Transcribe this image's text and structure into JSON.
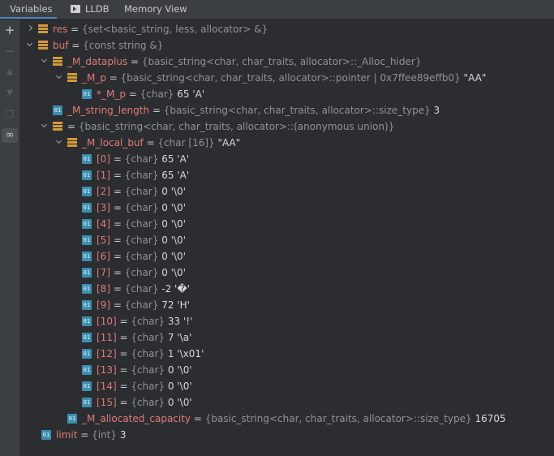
{
  "tabs": [
    {
      "label": "Variables",
      "active": true
    },
    {
      "label": "LLDB",
      "active": false
    },
    {
      "label": "Memory View",
      "active": false
    }
  ],
  "toolbar": {
    "add_icon": "plus-icon",
    "remove_icon": "minus-icon",
    "up_icon": "arrow-up-icon",
    "down_icon": "arrow-down-icon",
    "copy_icon": "copy-icon",
    "watches_icon": "glasses-icon"
  },
  "colors": {
    "background": "#2b2d30",
    "variable_name": "#e07b7b",
    "type_text": "#8f949a",
    "struct_icon": "#d29a3a",
    "primitive_icon": "#3d8fb0",
    "active_tab_underline": "#4a88c7"
  },
  "rows": [
    {
      "depth": 0,
      "expander": "right",
      "icon": "struct",
      "name": "res",
      "eq": " = ",
      "type": "{set<basic_string, less, allocator> &}",
      "value": ""
    },
    {
      "depth": 0,
      "expander": "down",
      "icon": "struct",
      "name": "buf",
      "eq": " = ",
      "type": "{const string &}",
      "value": ""
    },
    {
      "depth": 1,
      "expander": "down",
      "icon": "struct",
      "name": "_M_dataplus",
      "eq": " = ",
      "type": "{basic_string<char, char_traits, allocator>::_Alloc_hider}",
      "value": ""
    },
    {
      "depth": 2,
      "expander": "down",
      "icon": "struct",
      "name": "_M_p",
      "eq": " = ",
      "type": "{basic_string<char, char_traits, allocator>::pointer | 0x7ffee89effb0}",
      "value": " \"AA\""
    },
    {
      "depth": 3,
      "expander": "",
      "icon": "prim",
      "name": "*_M_p",
      "eq": " = ",
      "type": "{char}",
      "value": " 65 'A'"
    },
    {
      "depth": 1,
      "expander": "",
      "icon": "prim",
      "name": "_M_string_length",
      "eq": " = ",
      "type": "{basic_string<char, char_traits, allocator>::size_type}",
      "value": " 3"
    },
    {
      "depth": 1,
      "expander": "down",
      "icon": "struct",
      "name": "",
      "eq": " = ",
      "type": "{basic_string<char, char_traits, allocator>::(anonymous union)}",
      "value": ""
    },
    {
      "depth": 2,
      "expander": "down",
      "icon": "struct",
      "name": "_M_local_buf",
      "eq": " = ",
      "type": "{char [16]}",
      "value": " \"AA\""
    },
    {
      "depth": 3,
      "expander": "",
      "icon": "prim",
      "name": "[0]",
      "eq": " = ",
      "type": "{char}",
      "value": " 65 'A'"
    },
    {
      "depth": 3,
      "expander": "",
      "icon": "prim",
      "name": "[1]",
      "eq": " = ",
      "type": "{char}",
      "value": " 65 'A'"
    },
    {
      "depth": 3,
      "expander": "",
      "icon": "prim",
      "name": "[2]",
      "eq": " = ",
      "type": "{char}",
      "value": " 0 '\\0'"
    },
    {
      "depth": 3,
      "expander": "",
      "icon": "prim",
      "name": "[3]",
      "eq": " = ",
      "type": "{char}",
      "value": " 0 '\\0'"
    },
    {
      "depth": 3,
      "expander": "",
      "icon": "prim",
      "name": "[4]",
      "eq": " = ",
      "type": "{char}",
      "value": " 0 '\\0'"
    },
    {
      "depth": 3,
      "expander": "",
      "icon": "prim",
      "name": "[5]",
      "eq": " = ",
      "type": "{char}",
      "value": " 0 '\\0'"
    },
    {
      "depth": 3,
      "expander": "",
      "icon": "prim",
      "name": "[6]",
      "eq": " = ",
      "type": "{char}",
      "value": " 0 '\\0'"
    },
    {
      "depth": 3,
      "expander": "",
      "icon": "prim",
      "name": "[7]",
      "eq": " = ",
      "type": "{char}",
      "value": " 0 '\\0'"
    },
    {
      "depth": 3,
      "expander": "",
      "icon": "prim",
      "name": "[8]",
      "eq": " = ",
      "type": "{char}",
      "value": " -2 '�'"
    },
    {
      "depth": 3,
      "expander": "",
      "icon": "prim",
      "name": "[9]",
      "eq": " = ",
      "type": "{char}",
      "value": " 72 'H'"
    },
    {
      "depth": 3,
      "expander": "",
      "icon": "prim",
      "name": "[10]",
      "eq": " = ",
      "type": "{char}",
      "value": " 33 '!'"
    },
    {
      "depth": 3,
      "expander": "",
      "icon": "prim",
      "name": "[11]",
      "eq": " = ",
      "type": "{char}",
      "value": " 7 '\\a'"
    },
    {
      "depth": 3,
      "expander": "",
      "icon": "prim",
      "name": "[12]",
      "eq": " = ",
      "type": "{char}",
      "value": " 1 '\\x01'"
    },
    {
      "depth": 3,
      "expander": "",
      "icon": "prim",
      "name": "[13]",
      "eq": " = ",
      "type": "{char}",
      "value": " 0 '\\0'"
    },
    {
      "depth": 3,
      "expander": "",
      "icon": "prim",
      "name": "[14]",
      "eq": " = ",
      "type": "{char}",
      "value": " 0 '\\0'"
    },
    {
      "depth": 3,
      "expander": "",
      "icon": "prim",
      "name": "[15]",
      "eq": " = ",
      "type": "{char}",
      "value": " 0 '\\0'"
    },
    {
      "depth": 2,
      "expander": "",
      "icon": "prim",
      "name": "_M_allocated_capacity",
      "eq": " = ",
      "type": "{basic_string<char, char_traits, allocator>::size_type}",
      "value": " 16705"
    },
    {
      "depth": 0,
      "expander": "",
      "icon": "prim",
      "name": "limit",
      "eq": " = ",
      "type": "{int}",
      "value": " 3"
    }
  ]
}
